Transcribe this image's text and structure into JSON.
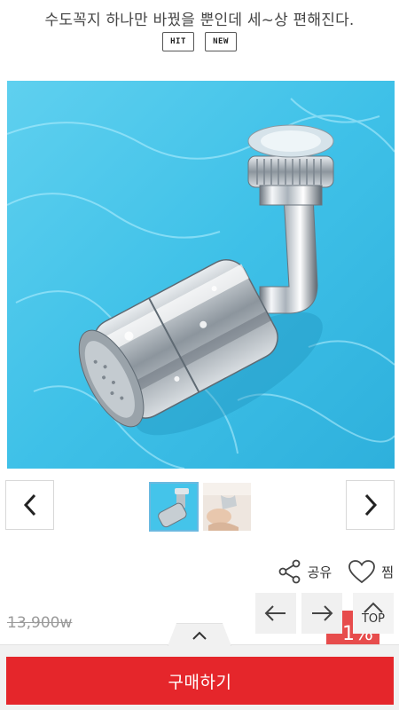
{
  "product": {
    "subtitle": "수도꼭지 하나만 바꿨을 뿐인데 세~상 편해진다.",
    "badges": [
      "HIT",
      "NEW"
    ]
  },
  "gallery": {
    "hero_image": "faucet-aerator-on-water",
    "thumbnails": [
      "faucet-aerator-blue",
      "faucet-in-use"
    ],
    "active_index": 0,
    "prev_icon": "chevron-left-icon",
    "next_icon": "chevron-right-icon"
  },
  "actions": {
    "share_label": "공유",
    "wish_label": "찜",
    "share_icon": "share-icon",
    "wish_icon": "heart-icon"
  },
  "pricing": {
    "original_price": "13,900w",
    "sale_peek": "1%"
  },
  "floating_nav": {
    "top_label": "TOP"
  },
  "footer": {
    "buy_label": "구매하기",
    "buy_color": "#e5262b"
  }
}
